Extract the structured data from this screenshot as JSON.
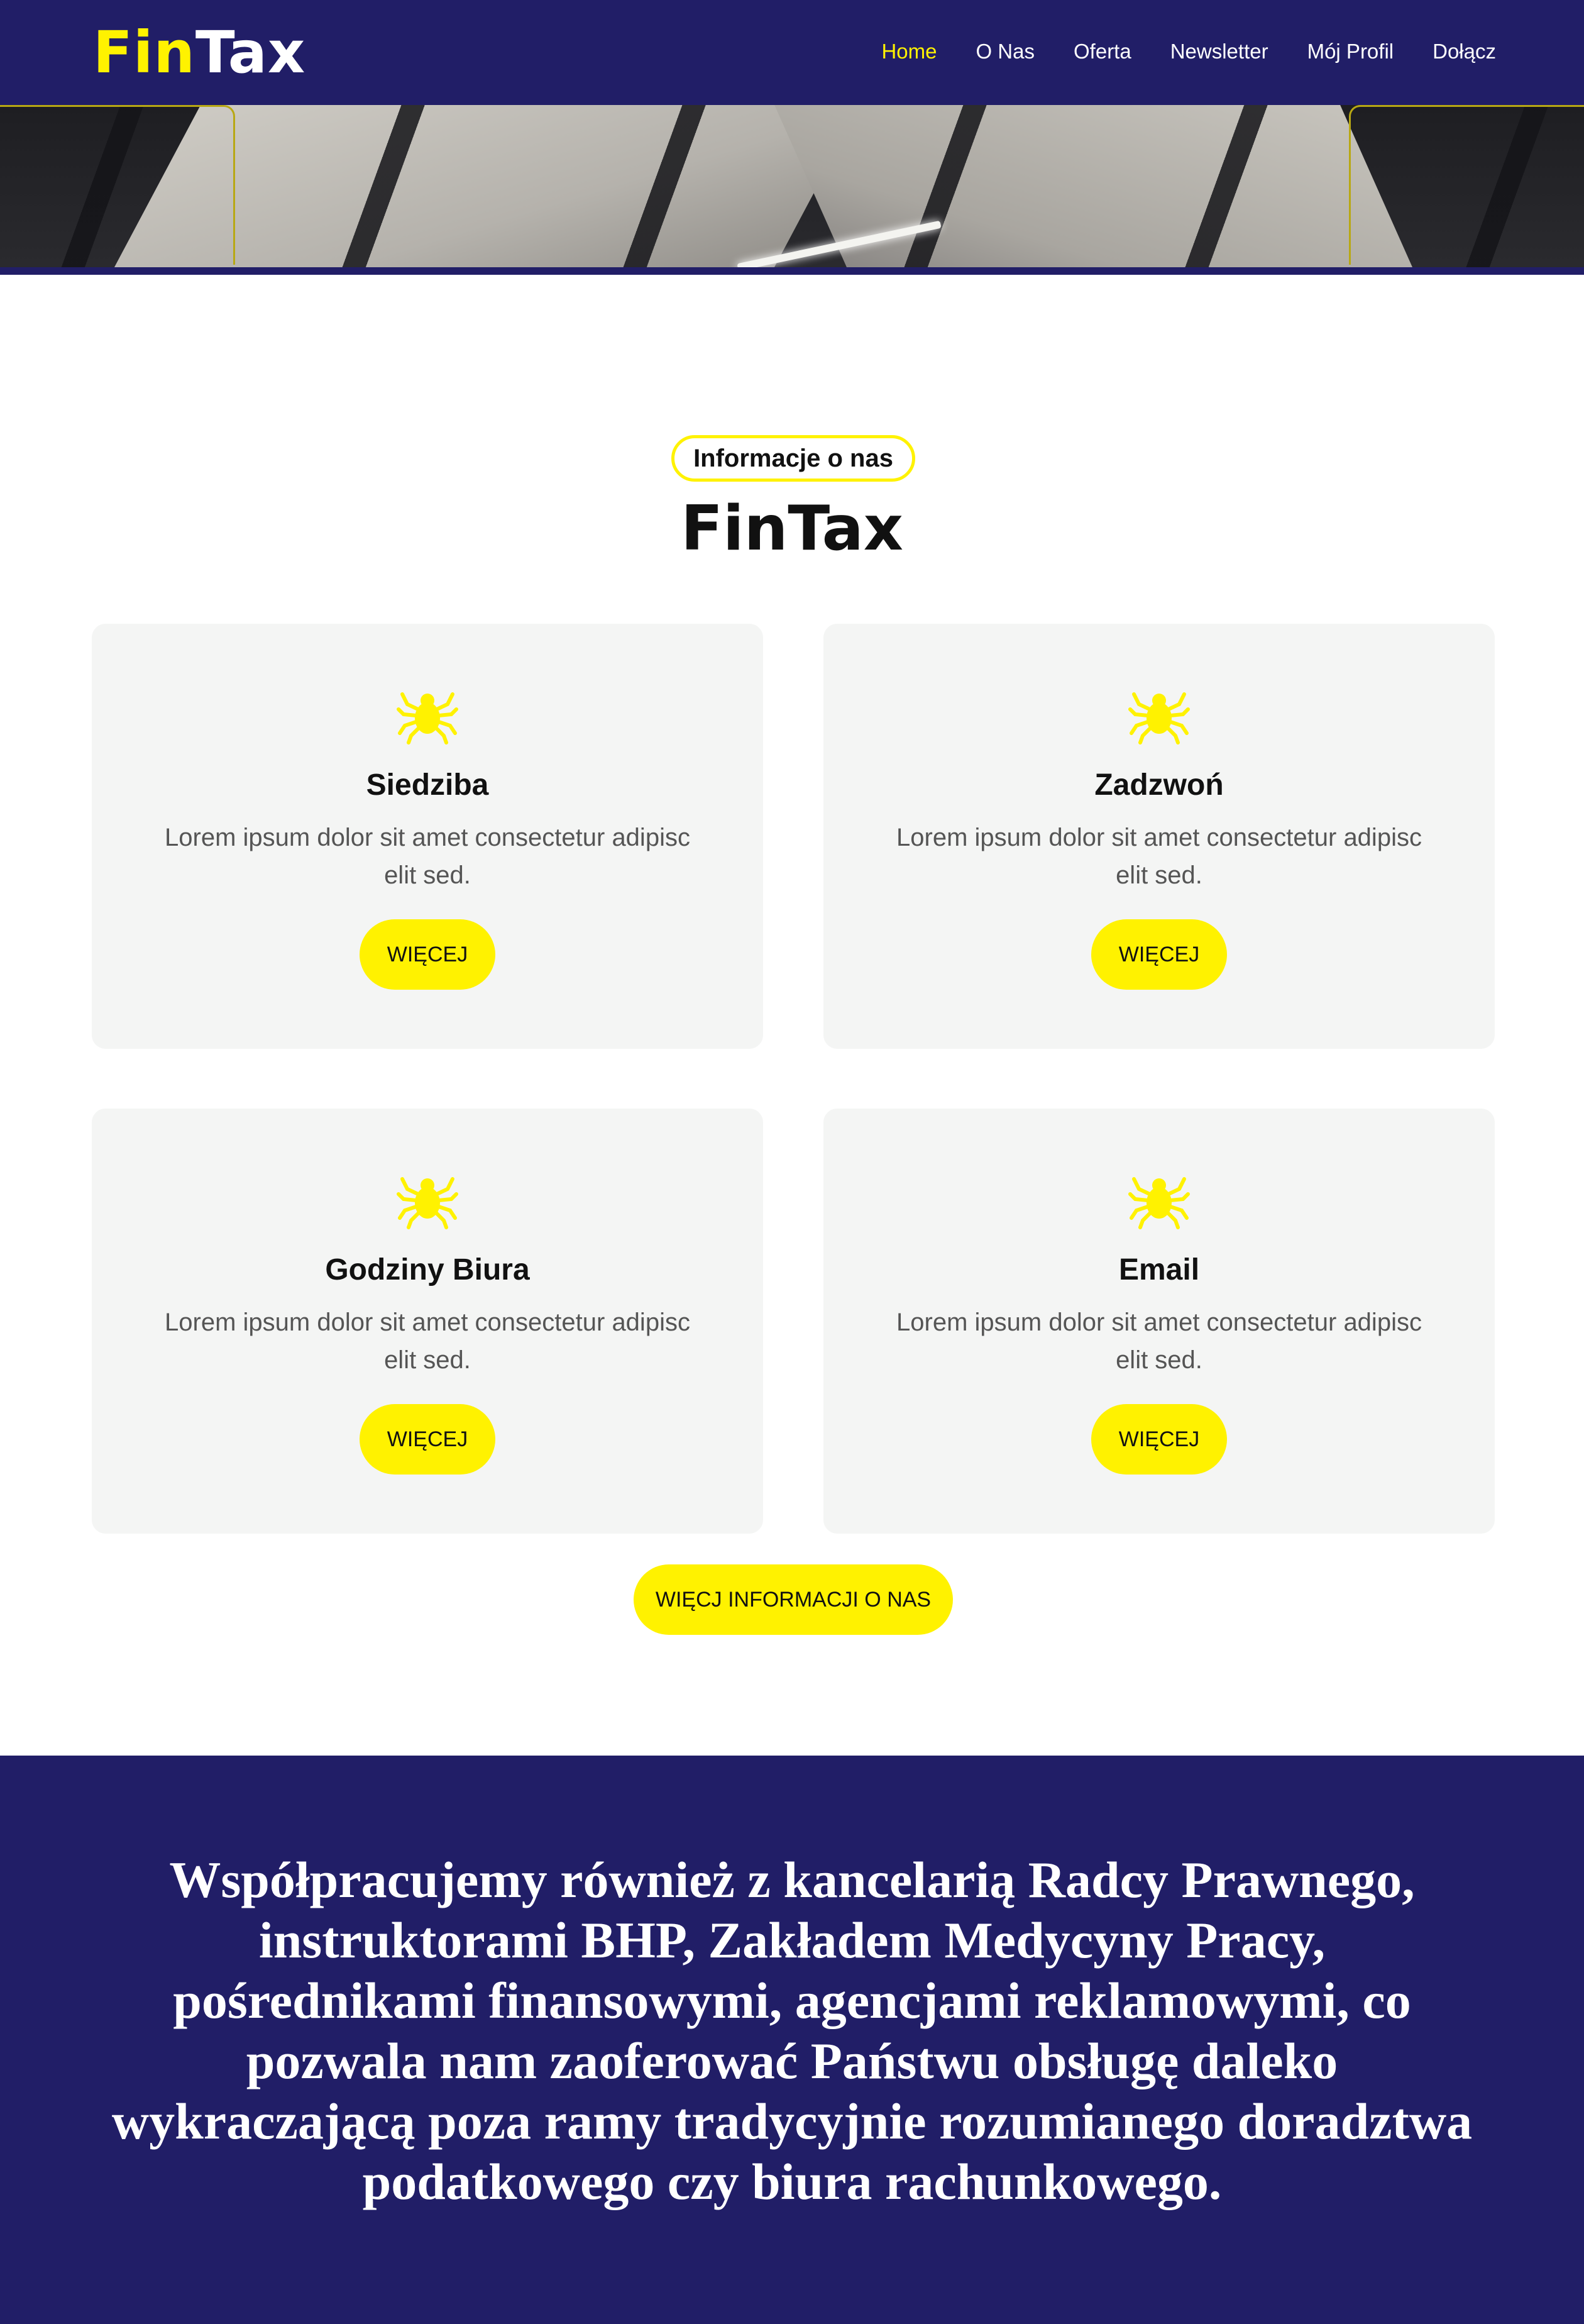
{
  "colors": {
    "navy": "#211e67",
    "yellow": "#fff200",
    "card_bg": "#f4f5f4"
  },
  "header": {
    "logo_part1": "Fin",
    "logo_part2": "Tax",
    "nav": [
      "Home",
      "O Nas",
      "Oferta",
      "Newsletter",
      "Mój Profil",
      "Dołącz"
    ],
    "active_nav": "Home"
  },
  "section": {
    "label": "Informacje o nas",
    "title": "FinTax"
  },
  "cards": [
    {
      "icon": "spider-icon",
      "title": "Siedziba",
      "desc": "Lorem ipsum dolor sit amet consectetur adipisc elit sed.",
      "button": "WIĘCEJ"
    },
    {
      "icon": "spider-icon",
      "title": "Zadzwoń",
      "desc": "Lorem ipsum dolor sit amet consectetur adipisc elit sed.",
      "button": "WIĘCEJ"
    },
    {
      "icon": "spider-icon",
      "title": "Godziny Biura",
      "desc": "Lorem ipsum dolor sit amet consectetur adipisc elit sed.",
      "button": "WIĘCEJ"
    },
    {
      "icon": "spider-icon",
      "title": "Email",
      "desc": "Lorem ipsum dolor sit amet consectetur adipisc elit sed.",
      "button": "WIĘCEJ"
    }
  ],
  "more_button": "WIĘCJ INFORMACJI O NAS",
  "band": {
    "text": "Współpracujemy również z kancelarią Radcy Prawnego, instruktorami BHP, Zakładem Medycyny Pracy, pośrednikami finansowymi, agencjami reklamowymi, co pozwala nam zaoferować Państwu obsługę daleko wykraczającą poza ramy tradycyjnie rozumianego doradztwa podatkowego czy biura rachunkowego."
  }
}
